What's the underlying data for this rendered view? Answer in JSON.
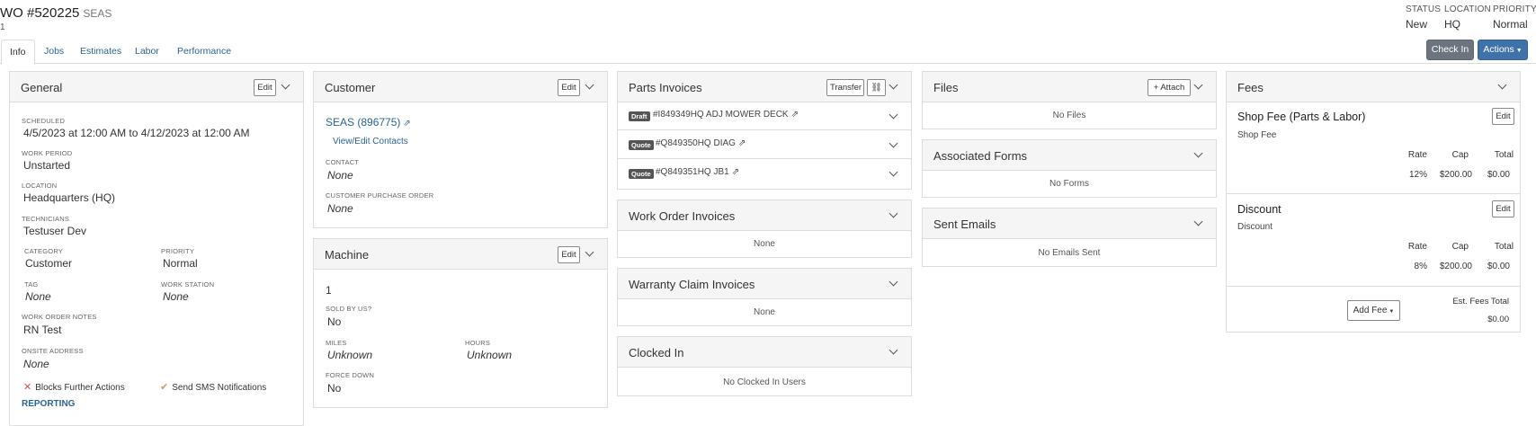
{
  "header": {
    "wo_title": "WO #520225",
    "wo_sub": "SEAS",
    "wo_line2": "1",
    "status_label": "STATUS",
    "status_value": "New",
    "location_label": "LOCATION",
    "location_value": "HQ",
    "priority_label": "PRIORITY",
    "priority_value": "Normal",
    "check_in": "Check In",
    "actions": "Actions"
  },
  "tabs": [
    "Info",
    "Jobs",
    "Estimates",
    "Labor",
    "Performance"
  ],
  "general": {
    "title": "General",
    "edit": "Edit",
    "scheduled_label": "SCHEDULED",
    "scheduled_value": "4/5/2023 at 12:00 AM to 4/12/2023 at 12:00 AM",
    "work_period_label": "WORK PERIOD",
    "work_period_value": "Unstarted",
    "location_label": "LOCATION",
    "location_value": "Headquarters (HQ)",
    "technicians_label": "TECHNICIANS",
    "technicians_value": "Testuser Dev",
    "category_label": "CATEGORY",
    "category_value": "Customer",
    "priority_label": "PRIORITY",
    "priority_value": "Normal",
    "tag_label": "TAG",
    "tag_value": "None",
    "work_station_label": "WORK STATION",
    "work_station_value": "None",
    "notes_label": "WORK ORDER NOTES",
    "notes_value": "RN Test",
    "onsite_label": "ONSITE ADDRESS",
    "onsite_value": "None",
    "blocks_label": "Blocks Further Actions",
    "sms_label": "Send SMS Notifications",
    "reporting": "REPORTING"
  },
  "customer": {
    "title": "Customer",
    "edit": "Edit",
    "name": "SEAS (896775)",
    "view_edit_contacts": "View/Edit Contacts",
    "contact_label": "CONTACT",
    "contact_value": "None",
    "po_label": "CUSTOMER PURCHASE ORDER",
    "po_value": "None"
  },
  "machine": {
    "title": "Machine",
    "edit": "Edit",
    "value": "1",
    "sold_label": "SOLD BY US?",
    "sold_value": "No",
    "miles_label": "MILES",
    "miles_value": "Unknown",
    "hours_label": "HOURS",
    "hours_value": "Unknown",
    "force_down_label": "FORCE DOWN",
    "force_down_value": "No"
  },
  "parts_invoices": {
    "title": "Parts Invoices",
    "transfer": "Transfer",
    "items": [
      {
        "badge": "Draft",
        "text": "#I849349HQ ADJ MOWER DECK"
      },
      {
        "badge": "Quote",
        "text": "#Q849350HQ DIAG"
      },
      {
        "badge": "Quote",
        "text": "#Q849351HQ JB1"
      }
    ]
  },
  "work_order_invoices": {
    "title": "Work Order Invoices",
    "empty": "None"
  },
  "warranty_claim_invoices": {
    "title": "Warranty Claim Invoices",
    "empty": "None"
  },
  "clocked_in": {
    "title": "Clocked In",
    "empty": "No Clocked In Users"
  },
  "files": {
    "title": "Files",
    "attach": "+ Attach",
    "empty": "No Files"
  },
  "associated_forms": {
    "title": "Associated Forms",
    "empty": "No Forms"
  },
  "sent_emails": {
    "title": "Sent Emails",
    "empty": "No Emails Sent"
  },
  "fees": {
    "title": "Fees",
    "items": [
      {
        "name": "Shop Fee (Parts & Labor)",
        "sub": "Shop Fee",
        "edit": "Edit",
        "rate_label": "Rate",
        "cap_label": "Cap",
        "total_label": "Total",
        "rate": "12%",
        "cap": "$200.00",
        "total": "$0.00"
      },
      {
        "name": "Discount",
        "sub": "Discount",
        "edit": "Edit",
        "rate_label": "Rate",
        "cap_label": "Cap",
        "total_label": "Total",
        "rate": "8%",
        "cap": "$200.00",
        "total": "$0.00"
      }
    ],
    "add_fee": "Add Fee",
    "est_total_label": "Est. Fees Total",
    "est_total_value": "$0.00"
  },
  "colors": {
    "link": "#2a6496",
    "check_in_bg": "#6c757d",
    "actions_bg": "#3f72a8",
    "panel_header_bg": "#f5f5f5",
    "x_icon": "#d9534f",
    "check_icon": "#c8a060"
  }
}
